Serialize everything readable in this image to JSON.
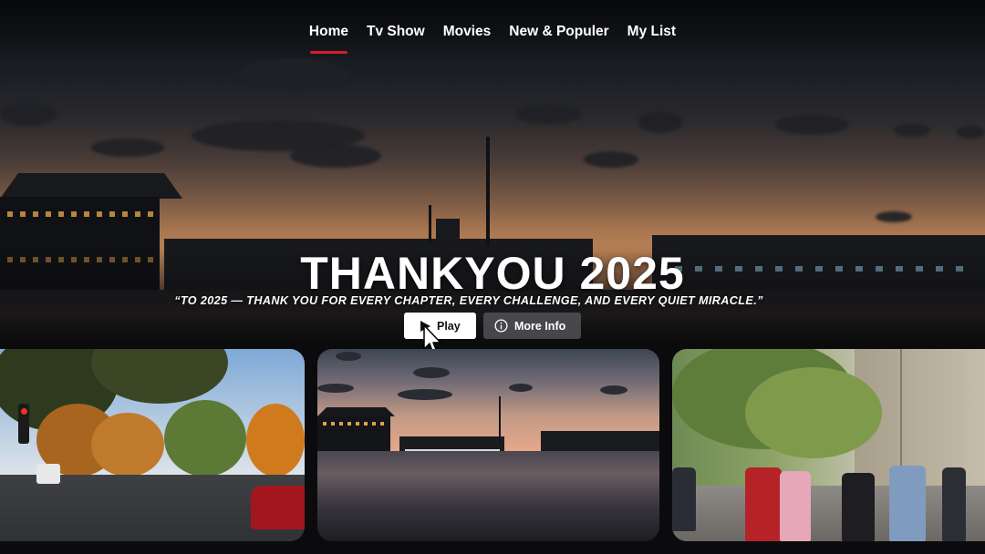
{
  "nav": {
    "items": [
      "Home",
      "Tv Show",
      "Movies",
      "New & Populer",
      "My List"
    ],
    "active_index": 0
  },
  "hero": {
    "title": "THANKYOU 2025",
    "quote": "“TO 2025 — THANK YOU FOR EVERY CHAPTER, EVERY CHALLENGE, AND EVERY QUIET MIRACLE.”",
    "play_label": "Play",
    "info_label": "More Info",
    "play_icon": "play-icon",
    "info_icon": "info-icon"
  },
  "colors": {
    "accent": "#d21f2c",
    "background": "#0b0b0d"
  }
}
